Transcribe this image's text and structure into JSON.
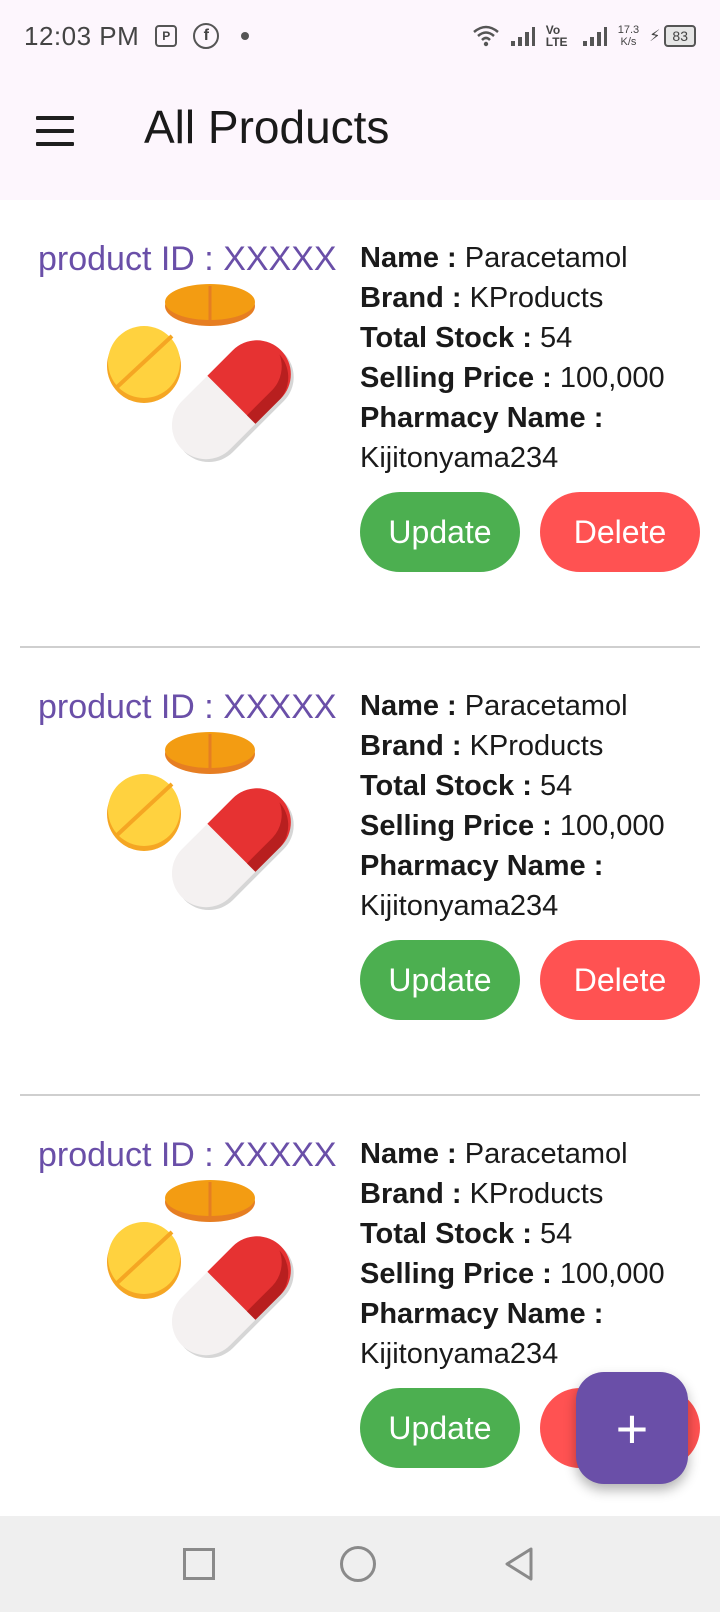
{
  "status_bar": {
    "time": "12:03 PM",
    "speed_top": "17.3",
    "speed_bottom": "K/s",
    "battery": "83",
    "network_label": "Vo LTE"
  },
  "app_bar": {
    "title": "All Products",
    "menu_icon": "hamburger-menu-icon"
  },
  "labels": {
    "name": "Name :",
    "brand": "Brand :",
    "total_stock": "Total Stock :",
    "selling_price": "Selling Price :",
    "pharmacy_name": "Pharmacy Name :",
    "update": "Update",
    "delete": "Delete"
  },
  "products": [
    {
      "id_label": "product ID : XXXXX",
      "name": "Paracetamol",
      "brand": "KProducts",
      "total_stock": "54",
      "selling_price": "100,000",
      "pharmacy_name": "Kijitonyama234"
    },
    {
      "id_label": "product ID : XXXXX",
      "name": "Paracetamol",
      "brand": "KProducts",
      "total_stock": "54",
      "selling_price": "100,000",
      "pharmacy_name": "Kijitonyama234"
    },
    {
      "id_label": "product ID : XXXXX",
      "name": "Paracetamol",
      "brand": "KProducts",
      "total_stock": "54",
      "selling_price": "100,000",
      "pharmacy_name": "Kijitonyama234"
    }
  ],
  "fab": {
    "label": "+",
    "icon": "add-icon"
  },
  "colors": {
    "accent": "#6a4fa8",
    "update": "#4caf50",
    "delete": "#ff5252",
    "app_bar_bg": "#fdf6fd"
  }
}
